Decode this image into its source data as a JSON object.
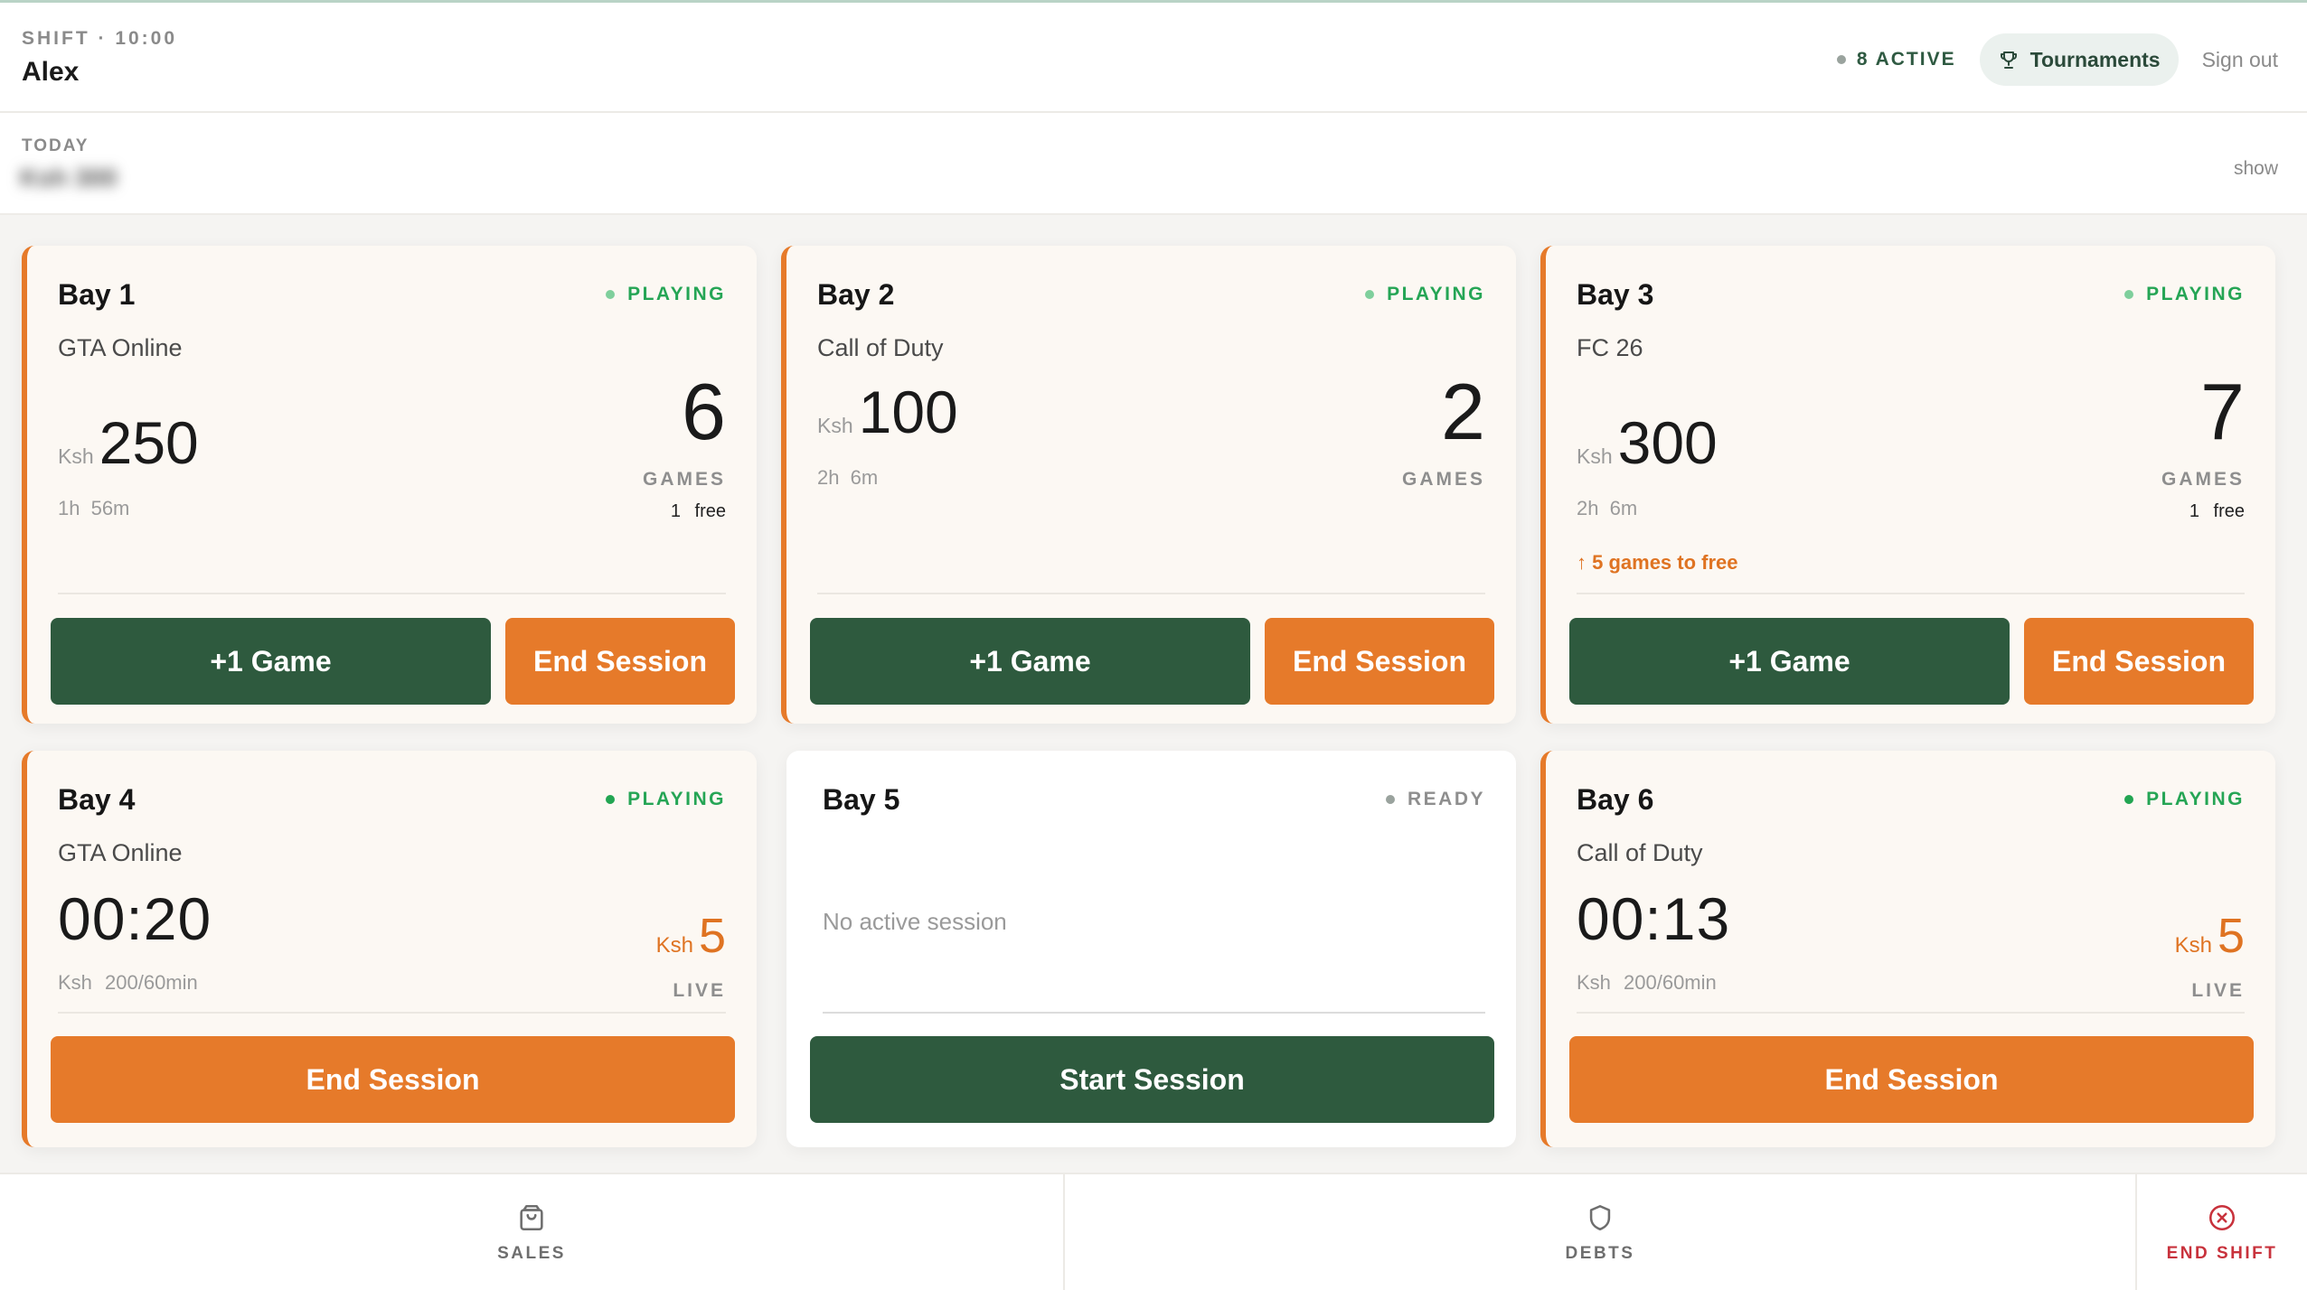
{
  "header": {
    "shift_label": "SHIFT · 10:00",
    "user_name": "Alex",
    "active_count": "8 ACTIVE",
    "tournaments_label": "Tournaments",
    "signout_label": "Sign out"
  },
  "today": {
    "label": "TODAY",
    "value": "Ksh 300",
    "toggle_label": "show"
  },
  "bays": [
    {
      "name": "Bay 1",
      "status": "PLAYING",
      "game": "GTA Online",
      "currency": "Ksh",
      "amount": "250",
      "elapsed": "1h 56m",
      "games": "6",
      "games_label": "GAMES",
      "free": "1 free",
      "add_label": "+1 Game",
      "end_label": "End Session"
    },
    {
      "name": "Bay 2",
      "status": "PLAYING",
      "game": "Call of Duty",
      "currency": "Ksh",
      "amount": "100",
      "elapsed": "2h 6m",
      "games": "2",
      "games_label": "GAMES",
      "add_label": "+1 Game",
      "end_label": "End Session"
    },
    {
      "name": "Bay 3",
      "status": "PLAYING",
      "game": "FC 26",
      "currency": "Ksh",
      "amount": "300",
      "elapsed": "2h 6m",
      "games": "7",
      "games_label": "GAMES",
      "free": "1 free",
      "bonus_note": "↑ 5 games to free",
      "add_label": "+1 Game",
      "end_label": "End Session"
    },
    {
      "name": "Bay 4",
      "status": "PLAYING",
      "game": "GTA Online",
      "timer": "00:20",
      "rate": "Ksh 200/60min",
      "live_currency": "Ksh",
      "live_amount": "5",
      "live_label": "LIVE",
      "end_label": "End Session"
    },
    {
      "name": "Bay 5",
      "status": "READY",
      "no_session": "No active session",
      "start_label": "Start Session"
    },
    {
      "name": "Bay 6",
      "status": "PLAYING",
      "game": "Call of Duty",
      "timer": "00:13",
      "rate": "Ksh 200/60min",
      "live_currency": "Ksh",
      "live_amount": "5",
      "live_label": "LIVE",
      "end_label": "End Session"
    }
  ],
  "nav": {
    "sales_label": "SALES",
    "debts_label": "DEBTS",
    "end_shift_label": "END SHIFT"
  },
  "colors": {
    "primary_green": "#2e5a3e",
    "accent_orange": "#e67a2a",
    "status_green": "#22a552",
    "danger_red": "#c8323c"
  }
}
